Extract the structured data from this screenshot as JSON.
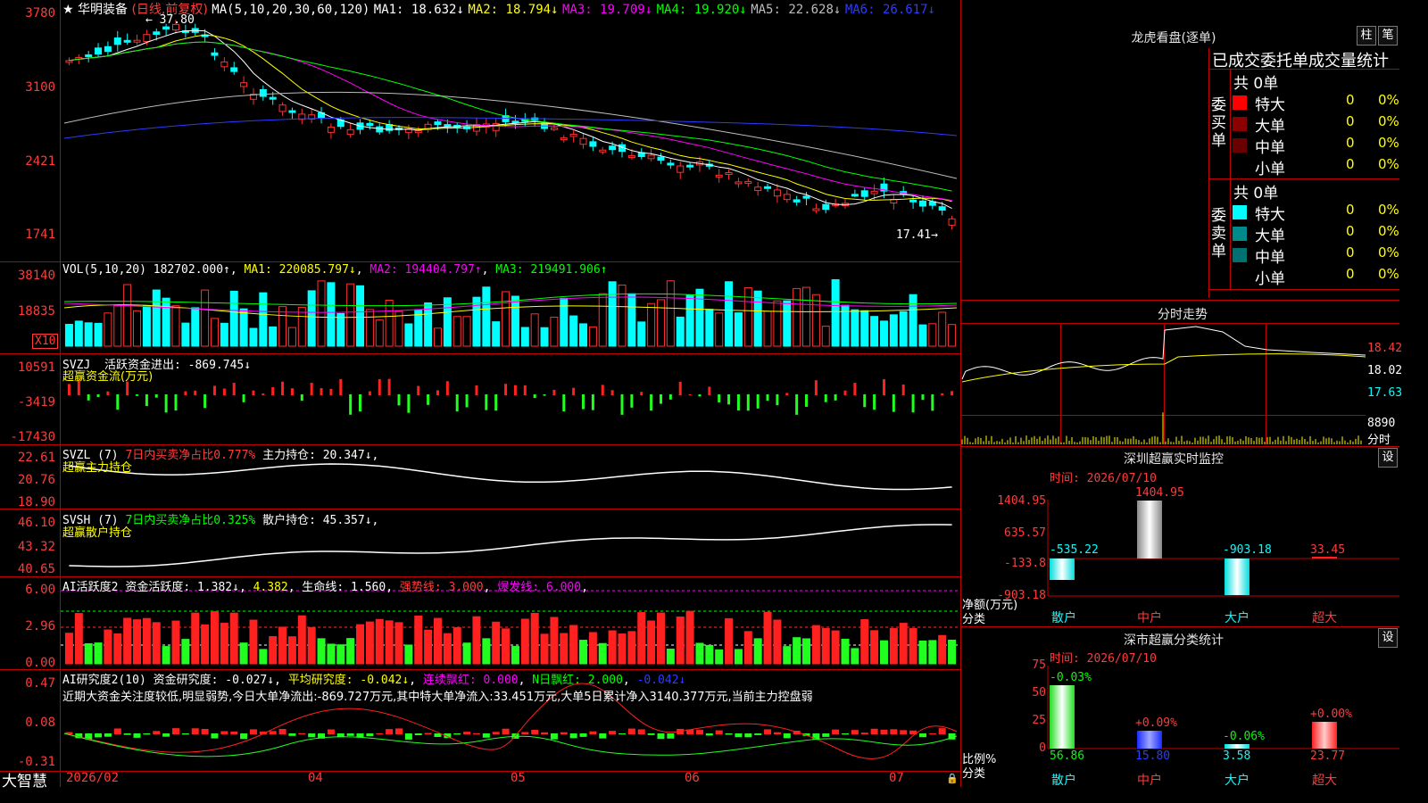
{
  "stock": {
    "name": "华明装备",
    "period": "(日线,前复权)",
    "star": "★"
  },
  "price_header": {
    "ma_label": "MA(5,10,20,30,60,120)",
    "items": [
      {
        "label": "MA1: 18.632↓",
        "color": "#ffffff"
      },
      {
        "label": "MA2: 18.794↓",
        "color": "#ffff00"
      },
      {
        "label": "MA3: 19.709↓",
        "color": "#ff00ff"
      },
      {
        "label": "MA4: 19.920↓",
        "color": "#00ff00"
      },
      {
        "label": "MA5: 22.628↓",
        "color": "#bdbdbd"
      },
      {
        "label": "MA6: 26.617↓",
        "color": "#2d3bff"
      }
    ],
    "high_mark": "37.80",
    "low_mark": "17.41"
  },
  "price_axis": [
    "3780",
    "3100",
    "2421",
    "1741"
  ],
  "vol_header": {
    "label": "VOL(5,10,20)",
    "value": "182702.000↑",
    "ma1": "MA1: 220085.797↓",
    "ma2": "MA2: 194404.797↑",
    "ma3": "MA3: 219491.906↑"
  },
  "vol_axis": [
    "38140",
    "18835"
  ],
  "vol_unit": "X10",
  "svzj": {
    "name": "SVZJ",
    "text": "活跃资金进出: -869.745↓",
    "sub": "超赢资金流(万元)",
    "axis": [
      "10591",
      "-3419",
      "-17430"
    ]
  },
  "svzl": {
    "name": "SVZL (7)",
    "text1": "7日内买卖净占比0.777%",
    "text2": "主力持仓: 20.347↓",
    "sub": "超赢主力持仓",
    "axis": [
      "22.61",
      "20.76",
      "18.90"
    ]
  },
  "svsh": {
    "name": "SVSH (7)",
    "text1": "7日内买卖净占比0.325%",
    "text2": "散户持仓: 45.357↓",
    "sub": "超赢散户持仓",
    "axis": [
      "46.10",
      "43.32",
      "40.65"
    ]
  },
  "ai_active": {
    "name": "AI活跃度2",
    "t1": "资金活跃度: 1.382↓",
    "t2": "4.382",
    "t3": "生命线: 1.560",
    "t4": "强势线: 3.000",
    "t5": "爆发线: 6.000",
    "axis": [
      "6.00",
      "2.96",
      "0.00"
    ]
  },
  "ai_research": {
    "name": "AI研究度2(10)",
    "t1": "资金研究度: -0.027↓",
    "t2": "平均研究度: -0.042↓",
    "t3": "连续飘红: 0.000",
    "t4": "N日飘红: 2.000",
    "t5": "-0.042↓",
    "comment": "近期大资金关注度较低,明显弱势,今日大单净流出:-869.727万元,其中特大单净流入:33.451万元,大单5日累计净入3140.377万元,当前主力控盘弱",
    "axis": [
      "0.47",
      "0.08",
      "-0.31"
    ]
  },
  "x_axis": [
    "2026/02",
    "04",
    "05",
    "06",
    "07"
  ],
  "brand": "大智慧",
  "right": {
    "lhb_title": "龙虎看盘(逐单)",
    "btn_bar": "柱",
    "btn_line": "笔",
    "tabs": [
      "已成交",
      "委托单",
      "成交量统计"
    ],
    "buy_label": "委买单",
    "sell_label": "委卖单",
    "buy_total": "共 0单",
    "sell_total": "共 0单",
    "buy_rows": [
      {
        "name": "特大",
        "count": "0",
        "pct": "0%",
        "color": "#ff0000"
      },
      {
        "name": "大单",
        "count": "0",
        "pct": "0%",
        "color": "#8b0000"
      },
      {
        "name": "中单",
        "count": "0",
        "pct": "0%",
        "color": "#6b0000"
      },
      {
        "name": "小单",
        "count": "0",
        "pct": "0%",
        "color": ""
      }
    ],
    "sell_rows": [
      {
        "name": "特大",
        "count": "0",
        "pct": "0%",
        "color": "#00ffff"
      },
      {
        "name": "大单",
        "count": "0",
        "pct": "0%",
        "color": "#008b8b"
      },
      {
        "name": "中单",
        "count": "0",
        "pct": "0%",
        "color": "#007070"
      },
      {
        "name": "小单",
        "count": "0",
        "pct": "0%",
        "color": ""
      }
    ],
    "intraday_title": "分时走势",
    "intraday_axis": [
      "18.42",
      "18.02",
      "17.63",
      "8890"
    ],
    "intraday_btn": "分时",
    "sz_title": "深圳超赢实时监控",
    "sz_btn": "设",
    "sz_time": "时间: 2026/07/10",
    "sz_axis": [
      "1404.95",
      "635.57",
      "-133.8",
      "-903.18"
    ],
    "sz_unit1": "净额(万元)",
    "sz_unit2": "分类",
    "sz_values": [
      {
        "cat": "散户",
        "label": "-535.22"
      },
      {
        "cat": "中户",
        "label": "1404.95"
      },
      {
        "cat": "大户",
        "label": "-903.18"
      },
      {
        "cat": "超大",
        "label": "33.45"
      }
    ],
    "ss_title": "深市超赢分类统计",
    "ss_btn": "设",
    "ss_time": "时间: 2026/07/10",
    "ss_axis": [
      "75",
      "50",
      "25",
      "0"
    ],
    "ss_unit1": "比例%",
    "ss_unit2": "分类",
    "ss_values": [
      {
        "cat": "散户",
        "top": "-0.03%",
        "bottom": "56.86"
      },
      {
        "cat": "中户",
        "top": "+0.09%",
        "bottom": "15.80"
      },
      {
        "cat": "大户",
        "top": "-0.06%",
        "bottom": "3.58"
      },
      {
        "cat": "超大",
        "top": "+0.00%",
        "bottom": "23.77"
      }
    ]
  },
  "chart_data": [
    {
      "type": "candlestick",
      "title": "华明装备 (日线,前复权)",
      "ylim": [
        17.41,
        37.8
      ],
      "series": [
        {
          "name": "MA1",
          "value": 18.632
        },
        {
          "name": "MA2",
          "value": 18.794
        },
        {
          "name": "MA3",
          "value": 19.709
        },
        {
          "name": "MA4",
          "value": 19.92
        },
        {
          "name": "MA5",
          "value": 22.628
        },
        {
          "name": "MA6",
          "value": 26.617
        }
      ]
    },
    {
      "type": "bar",
      "title": "VOL(5,10,20)",
      "value": 182702.0
    },
    {
      "type": "bar",
      "title": "SVZJ",
      "value": -869.745
    },
    {
      "type": "bar",
      "title": "深圳超赢实时监控",
      "categories": [
        "散户",
        "中户",
        "大户",
        "超大"
      ],
      "values": [
        -535.22,
        1404.95,
        -903.18,
        33.45
      ]
    },
    {
      "type": "bar",
      "title": "深市超赢分类统计",
      "categories": [
        "散户",
        "中户",
        "大户",
        "超大"
      ],
      "values": [
        56.86,
        15.8,
        3.58,
        23.77
      ]
    }
  ]
}
